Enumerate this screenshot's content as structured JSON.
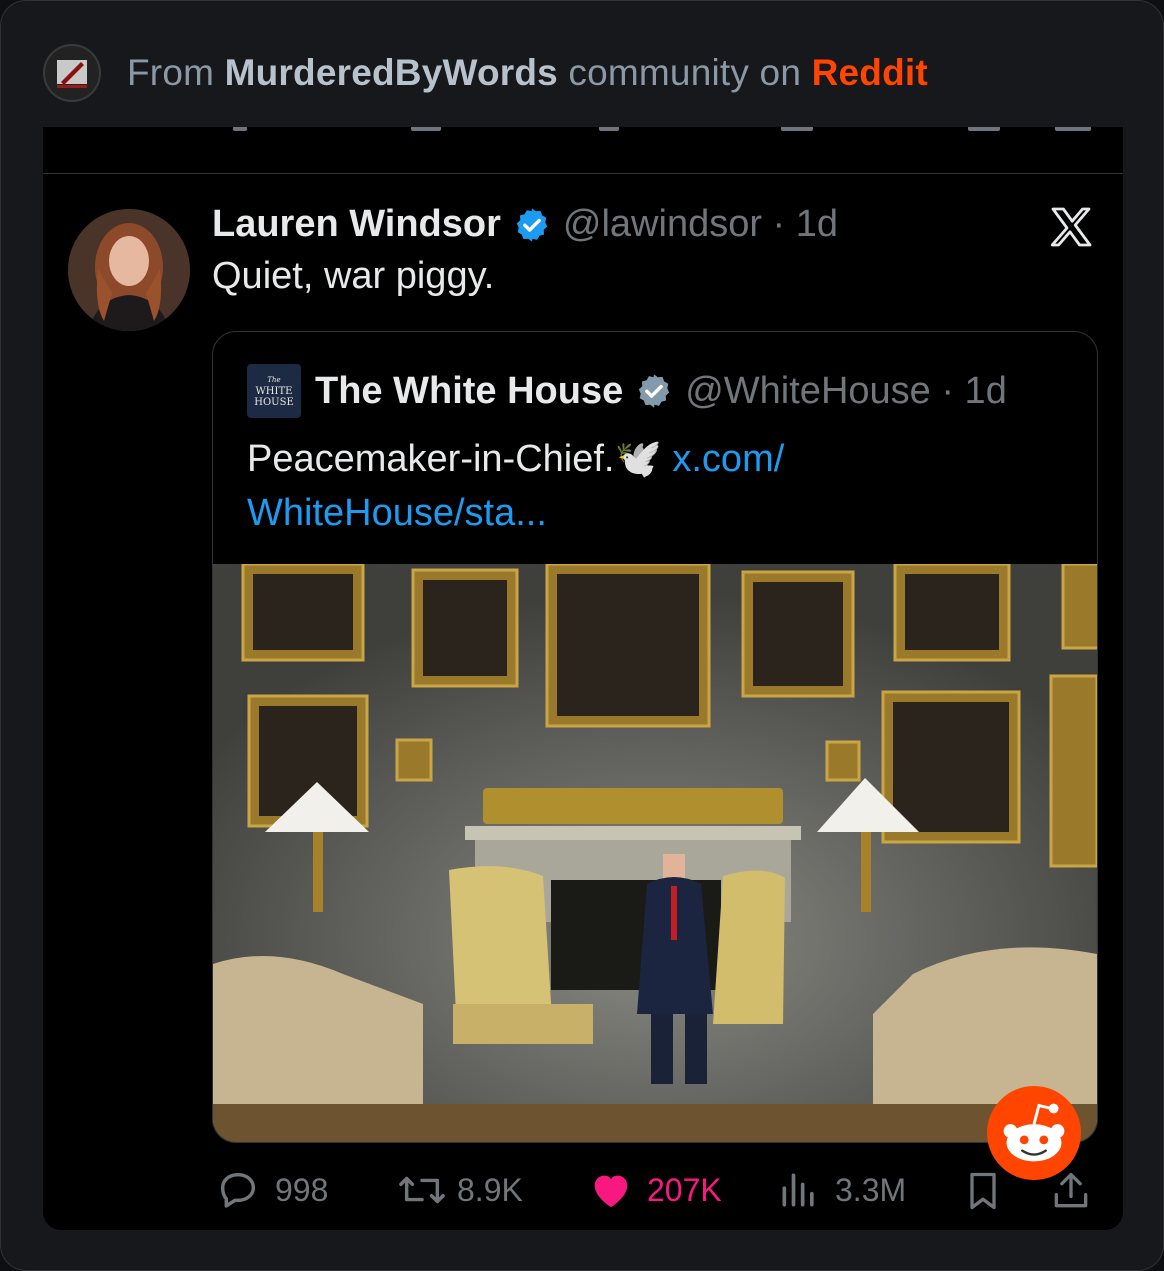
{
  "header": {
    "prefix": "From",
    "community": "MurderedByWords",
    "middle": "community on",
    "platform": "Reddit",
    "subreddit_icon": "murdered-by-words-community-icon"
  },
  "tweet": {
    "author_name": "Lauren Windsor",
    "author_handle": "@lawindsor · 1d",
    "text": "Quiet, war piggy.",
    "verified_color": "#1d9bf0",
    "platform_icon": "x-logo-icon"
  },
  "quoted_tweet": {
    "logo_lines": [
      "The",
      "WHITE",
      "HOUSE"
    ],
    "author_name": "The White House",
    "author_handle": "@WhiteHouse · 1d",
    "text": "Peacemaker-in-Chief.",
    "emoji": "🕊️",
    "link_text_1": "x.com/",
    "link_text_2": "WhiteHouse/sta...",
    "image_icon": "portrait-photo-in-formal-room"
  },
  "actions": {
    "replies": "998",
    "reposts": "8.9K",
    "likes": "207K",
    "views": "3.3M"
  },
  "colors": {
    "reddit_orange": "#ff4500",
    "like_pink": "#f91880",
    "link_blue": "#1d9bf0"
  }
}
